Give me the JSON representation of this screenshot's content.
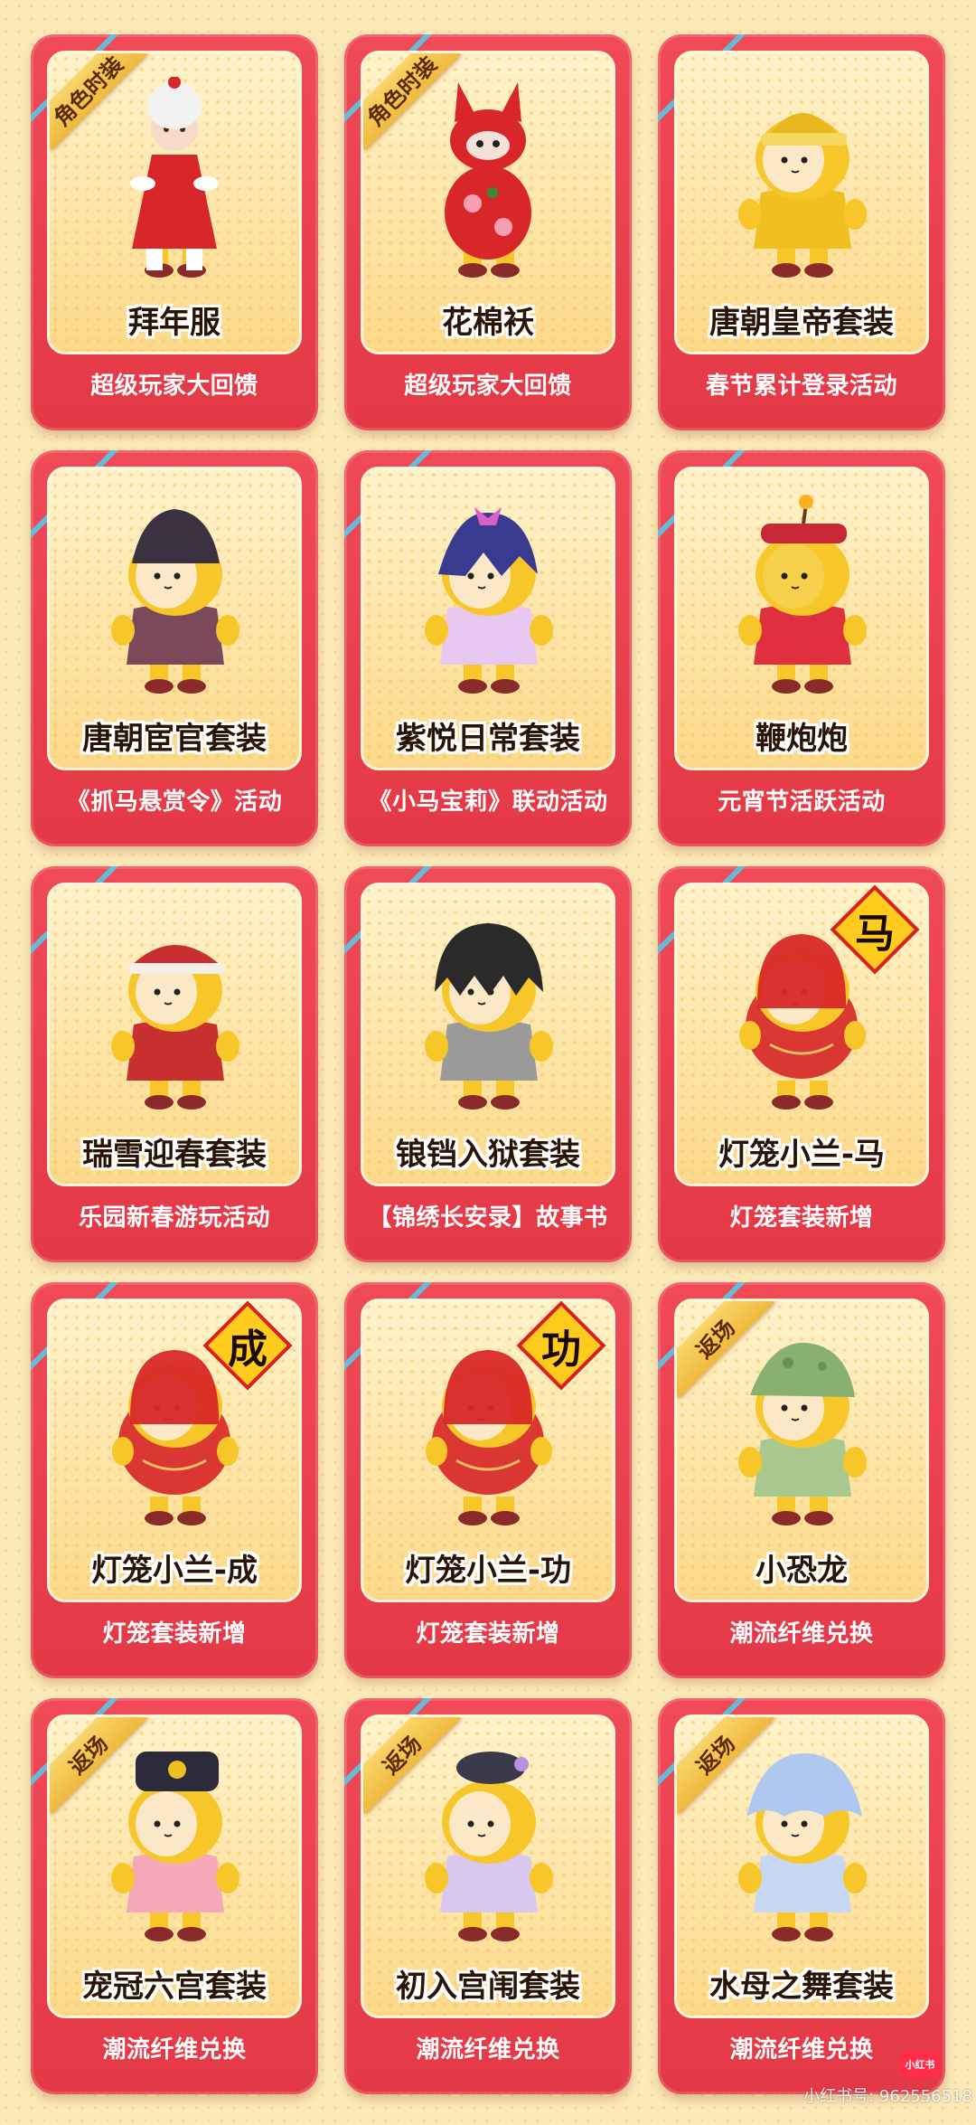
{
  "cards": [
    {
      "name": "拜年服",
      "subtitle": "超级玩家大回馈",
      "tag": "角色时装",
      "character": "girl-red-dress",
      "body_color": "#d8262b",
      "hat_color": "#f2f2f2",
      "face_color": "#f6dcc8"
    },
    {
      "name": "花棉袄",
      "subtitle": "超级玩家大回馈",
      "tag": "角色时装",
      "character": "bunny-floral",
      "body_color": "#d8262b",
      "hat_color": "#d8262b",
      "face_color": "#f4e2d8"
    },
    {
      "name": "唐朝皇帝套装",
      "subtitle": "春节累计登录活动",
      "tag": "",
      "character": "egg-emperor",
      "body_color": "#f0c020",
      "hat_color": "#e8b820",
      "face_color": "#fbe8c6"
    },
    {
      "name": "唐朝宦官套装",
      "subtitle": "《抓马悬赏令》活动",
      "tag": "",
      "character": "egg-eunuch",
      "body_color": "#7a4a5a",
      "hat_color": "#3a3240",
      "face_color": "#fbe8c6"
    },
    {
      "name": "紫悦日常套装",
      "subtitle": "《小马宝莉》联动活动",
      "tag": "",
      "character": "egg-twilight",
      "body_color": "#e8c8f0",
      "hat_color": "#3a3a90",
      "face_color": "#fbe8c6"
    },
    {
      "name": "鞭炮炮",
      "subtitle": "元宵节活跃活动",
      "tag": "",
      "character": "egg-firecracker",
      "body_color": "#e03040",
      "hat_color": "#e03040",
      "face_color": "#f6d04a"
    },
    {
      "name": "瑞雪迎春套装",
      "subtitle": "乐园新春游玩活动",
      "tag": "",
      "character": "egg-snow-spring",
      "body_color": "#c83030",
      "hat_color": "#c83030",
      "face_color": "#fbe8c6"
    },
    {
      "name": "锒铛入狱套装",
      "subtitle": "【锦绣长安录】故事书",
      "tag": "",
      "character": "egg-prisoner",
      "body_color": "#9a9a9a",
      "hat_color": "#2a2a2a",
      "face_color": "#fbe8c6"
    },
    {
      "name": "灯笼小兰-马",
      "subtitle": "灯笼套装新增",
      "tag": "",
      "character": "egg-lantern",
      "body_color": "#d82828",
      "hat_color": "#d82828",
      "face_color": "#fbe8c6",
      "sign": "马"
    },
    {
      "name": "灯笼小兰-成",
      "subtitle": "灯笼套装新增",
      "tag": "",
      "character": "egg-lantern",
      "body_color": "#d82828",
      "hat_color": "#d82828",
      "face_color": "#fbe8c6",
      "sign": "成"
    },
    {
      "name": "灯笼小兰-功",
      "subtitle": "灯笼套装新增",
      "tag": "",
      "character": "egg-lantern",
      "body_color": "#d82828",
      "hat_color": "#d82828",
      "face_color": "#fbe8c6",
      "sign": "功"
    },
    {
      "name": "小恐龙",
      "subtitle": "潮流纤维兑换",
      "tag": "返场",
      "character": "egg-dino",
      "body_color": "#a8c890",
      "hat_color": "#88b070",
      "face_color": "#fbe8c6"
    },
    {
      "name": "宠冠六宫套装",
      "subtitle": "潮流纤维兑换",
      "tag": "返场",
      "character": "egg-empress",
      "body_color": "#f4a8b8",
      "hat_color": "#2a2a3a",
      "face_color": "#fbe8c6"
    },
    {
      "name": "初入宫闱套装",
      "subtitle": "潮流纤维兑换",
      "tag": "返场",
      "character": "egg-palace-maid",
      "body_color": "#d8c8f0",
      "hat_color": "#3a3a4a",
      "face_color": "#fbe8c6"
    },
    {
      "name": "水母之舞套装",
      "subtitle": "潮流纤维兑换",
      "tag": "返场",
      "character": "egg-jellyfish",
      "body_color": "#c8d8f4",
      "hat_color": "#b0c8f0",
      "face_color": "#fbe8c6"
    }
  ],
  "watermark": {
    "logo_text": "小红书",
    "text": "小红书号: 962556518"
  }
}
